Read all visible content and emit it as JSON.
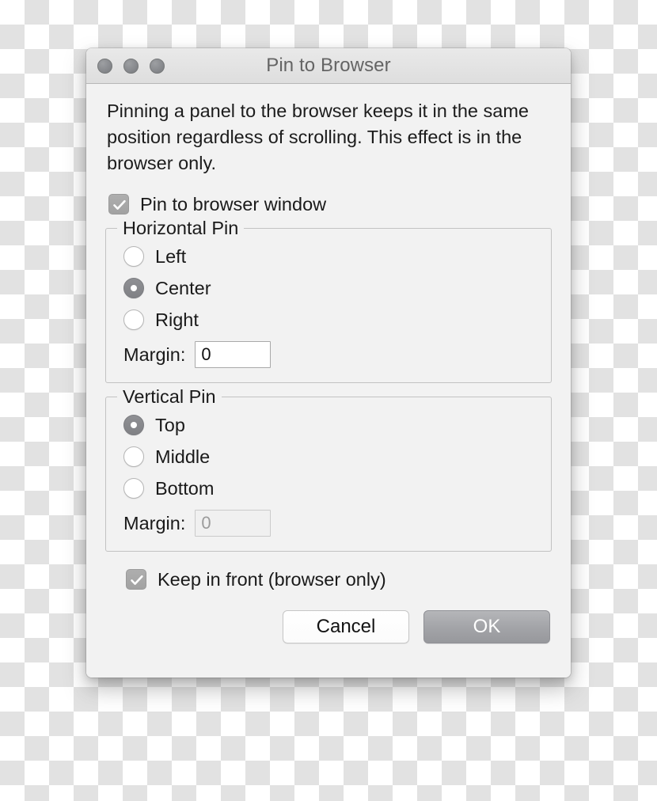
{
  "window": {
    "title": "Pin to Browser",
    "traffic_lights": [
      "close-button",
      "minimize-button",
      "zoom-button"
    ]
  },
  "body": {
    "description": "Pinning a panel to the browser keeps it in the same position regardless of scrolling. This effect is in the browser only."
  },
  "pin_checkbox": {
    "label": "Pin to browser window",
    "checked": true
  },
  "horizontal_group": {
    "legend": "Horizontal Pin",
    "options": [
      {
        "label": "Left",
        "selected": false
      },
      {
        "label": "Center",
        "selected": true
      },
      {
        "label": "Right",
        "selected": false
      }
    ],
    "margin_label": "Margin:",
    "margin_value": "0",
    "margin_disabled": false
  },
  "vertical_group": {
    "legend": "Vertical Pin",
    "options": [
      {
        "label": "Top",
        "selected": true
      },
      {
        "label": "Middle",
        "selected": false
      },
      {
        "label": "Bottom",
        "selected": false
      }
    ],
    "margin_label": "Margin:",
    "margin_value": "0",
    "margin_disabled": true
  },
  "keep_front_checkbox": {
    "label": "Keep in front (browser only)",
    "checked": true
  },
  "footer": {
    "cancel_label": "Cancel",
    "ok_label": "OK"
  },
  "colors": {
    "dialog_background": "#f2f2f2",
    "titlebar_top": "#e9e9e9",
    "titlebar_bottom": "#dedede",
    "title_text": "#646464",
    "body_text": "#1c1c1c",
    "control_gray": "#a2a2a2",
    "group_border": "#c2c2c2",
    "ok_button": "#a3a4a8",
    "disabled_text": "#9b9b9b"
  }
}
